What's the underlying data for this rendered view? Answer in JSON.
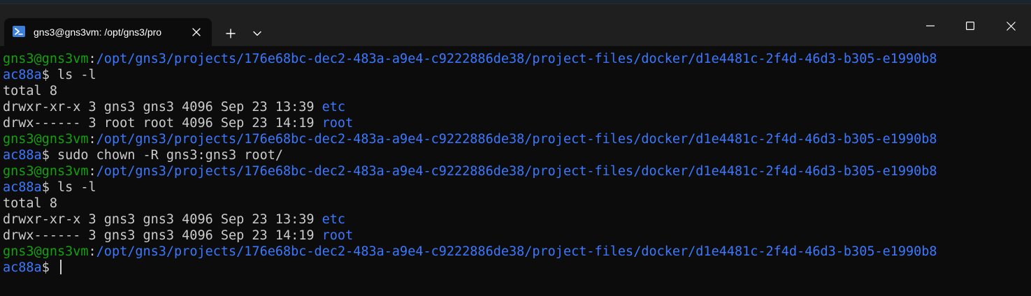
{
  "window": {
    "tab_title": "gns3@gns3vm: /opt/gns3/pro",
    "tab_icon": "powershell-terminal-icon",
    "buttons": {
      "new_tab": "+",
      "dropdown": "chevron-down",
      "minimize": "minimize",
      "maximize": "maximize",
      "close": "close"
    }
  },
  "colors": {
    "background": "#0c0c0c",
    "titlebar": "#1f1f1f",
    "prompt_user": "#13a10e",
    "path_and_dir": "#3b78ff",
    "text": "#cccccc"
  },
  "terminal": {
    "lines": [
      [
        {
          "t": "gns3@gns3vm",
          "c": "green"
        },
        {
          "t": ":",
          "c": "plain"
        },
        {
          "t": "/opt/gns3/projects/176e68bc-dec2-483a-a9e4-c9222886de38/project-files/docker/d1e4481c-2f4d-46d3-b305-e1990b8",
          "c": "blue"
        }
      ],
      [
        {
          "t": "ac88a",
          "c": "blue"
        },
        {
          "t": "$ ls -l",
          "c": "plain"
        }
      ],
      [
        {
          "t": "total 8",
          "c": "plain"
        }
      ],
      [
        {
          "t": "drwxr-xr-x 3 gns3 gns3 4096 Sep 23 13:39 ",
          "c": "plain"
        },
        {
          "t": "etc",
          "c": "blue"
        }
      ],
      [
        {
          "t": "drwx------ 3 root root 4096 Sep 23 14:19 ",
          "c": "plain"
        },
        {
          "t": "root",
          "c": "blue"
        }
      ],
      [
        {
          "t": "gns3@gns3vm",
          "c": "green"
        },
        {
          "t": ":",
          "c": "plain"
        },
        {
          "t": "/opt/gns3/projects/176e68bc-dec2-483a-a9e4-c9222886de38/project-files/docker/d1e4481c-2f4d-46d3-b305-e1990b8",
          "c": "blue"
        }
      ],
      [
        {
          "t": "ac88a",
          "c": "blue"
        },
        {
          "t": "$ sudo chown -R gns3:gns3 root/",
          "c": "plain"
        }
      ],
      [
        {
          "t": "gns3@gns3vm",
          "c": "green"
        },
        {
          "t": ":",
          "c": "plain"
        },
        {
          "t": "/opt/gns3/projects/176e68bc-dec2-483a-a9e4-c9222886de38/project-files/docker/d1e4481c-2f4d-46d3-b305-e1990b8",
          "c": "blue"
        }
      ],
      [
        {
          "t": "ac88a",
          "c": "blue"
        },
        {
          "t": "$ ls -l",
          "c": "plain"
        }
      ],
      [
        {
          "t": "total 8",
          "c": "plain"
        }
      ],
      [
        {
          "t": "drwxr-xr-x 3 gns3 gns3 4096 Sep 23 13:39 ",
          "c": "plain"
        },
        {
          "t": "etc",
          "c": "blue"
        }
      ],
      [
        {
          "t": "drwx------ 3 gns3 gns3 4096 Sep 23 14:19 ",
          "c": "plain"
        },
        {
          "t": "root",
          "c": "blue"
        }
      ],
      [
        {
          "t": "gns3@gns3vm",
          "c": "green"
        },
        {
          "t": ":",
          "c": "plain"
        },
        {
          "t": "/opt/gns3/projects/176e68bc-dec2-483a-a9e4-c9222886de38/project-files/docker/d1e4481c-2f4d-46d3-b305-e1990b8",
          "c": "blue"
        }
      ],
      [
        {
          "t": "ac88a",
          "c": "blue"
        },
        {
          "t": "$ ",
          "c": "plain"
        }
      ]
    ],
    "cursor_visible": true
  }
}
